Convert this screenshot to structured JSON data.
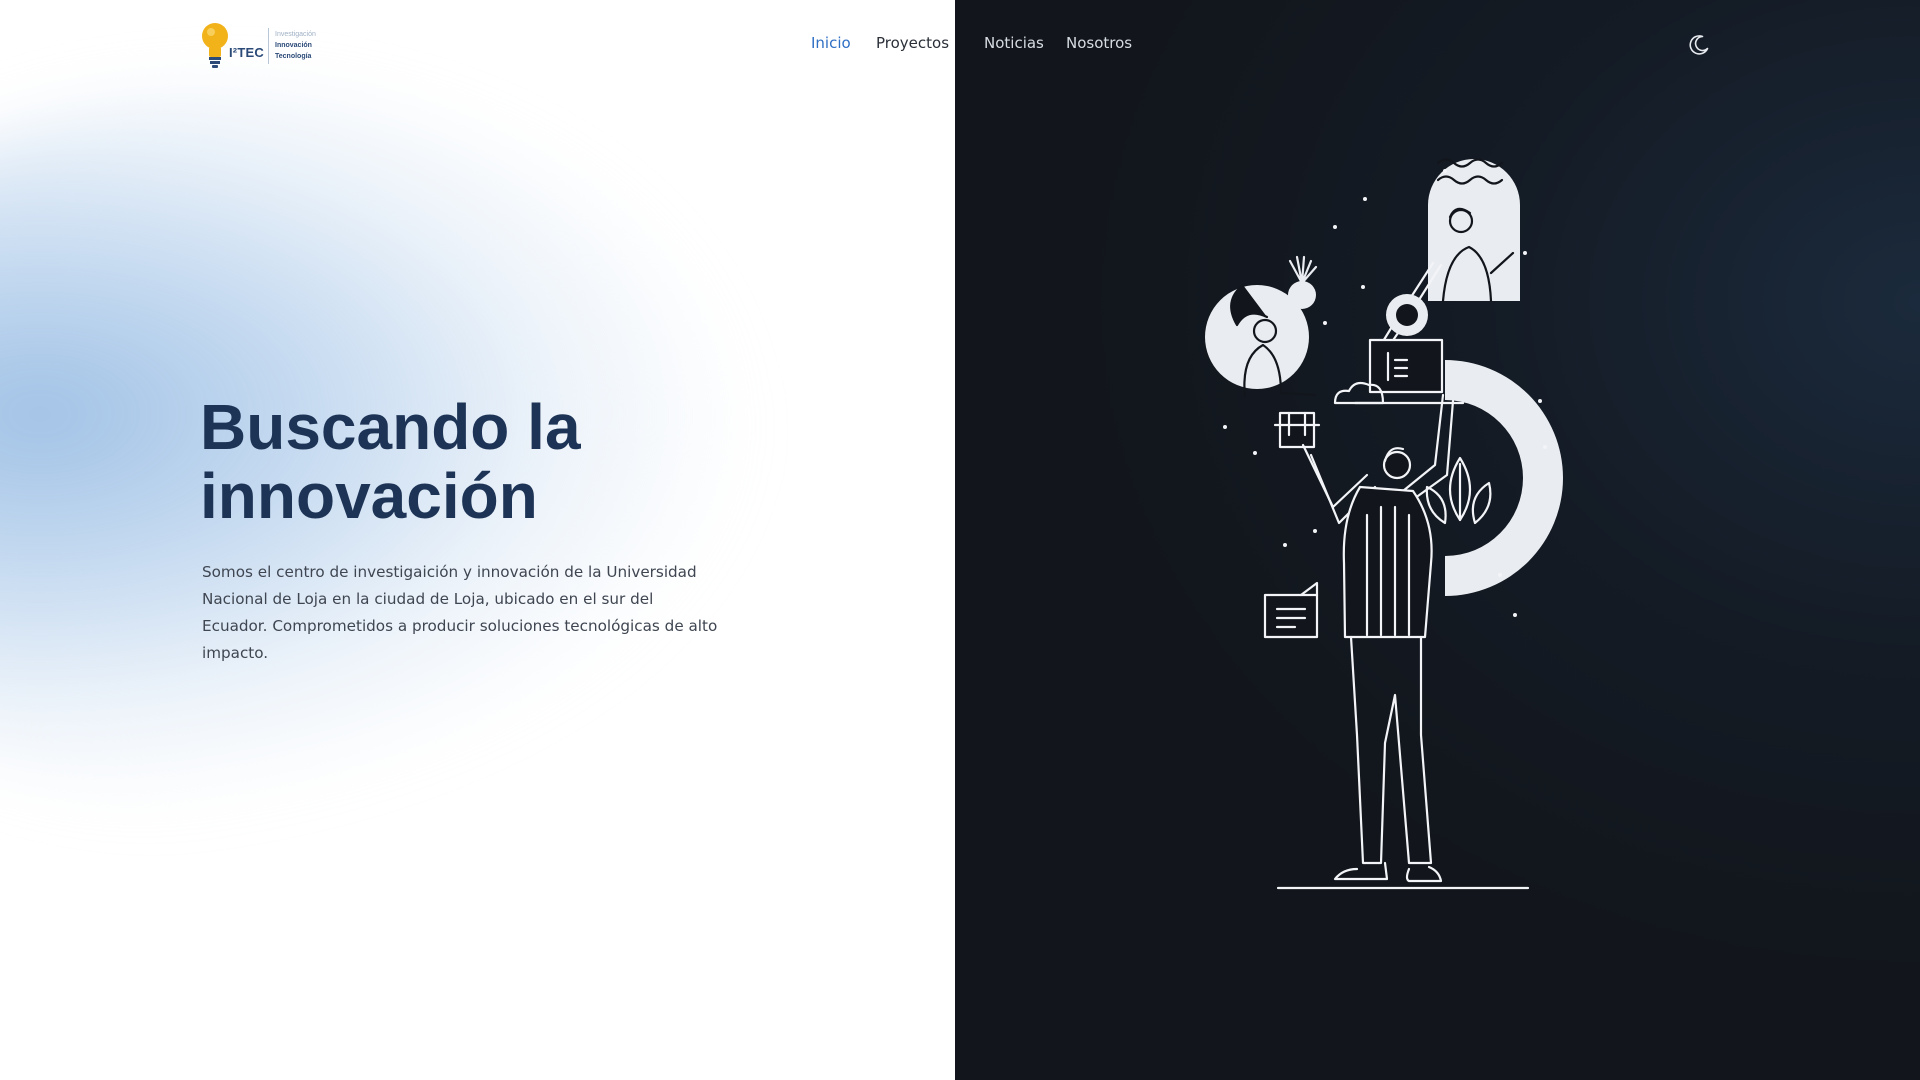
{
  "brand": {
    "logo_text": "I²TEC",
    "logo_lines": [
      "Investigación",
      "Innovación",
      "Tecnología"
    ]
  },
  "nav": {
    "items": [
      {
        "label": "Inicio",
        "active": true
      },
      {
        "label": "Proyectos",
        "active": false
      },
      {
        "label": "Noticias",
        "active": false
      },
      {
        "label": "Nosotros",
        "active": false
      }
    ],
    "theme_toggle_icon": "moon-icon"
  },
  "hero": {
    "title_line1": "Buscando la",
    "title_line2": "innovación",
    "description": "Somos el centro de investigaición y innovación de la Universidad Nacional de Loja en la ciudad de Loja, ubicado en el sur del Ecuador. Comprometidos a producir soluciones tecnológicas de alto impacto."
  },
  "colors": {
    "accent": "#2f6fc4",
    "title": "#1d3456",
    "dark_bg": "#12161c",
    "logo_bulb": "#f2b21a"
  }
}
